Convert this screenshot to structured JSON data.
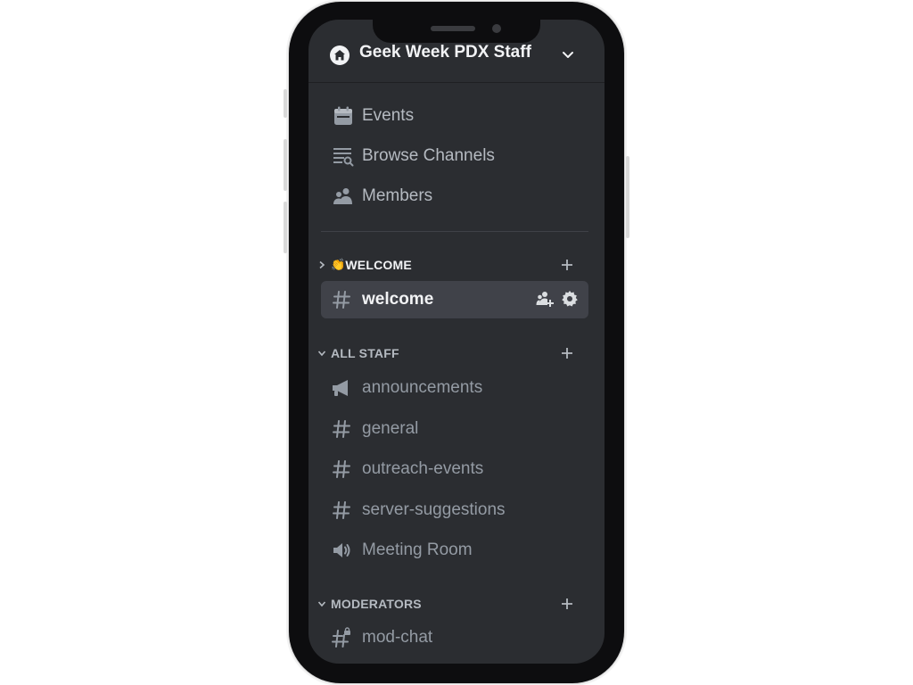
{
  "server": {
    "name": "Geek Week PDX Staff"
  },
  "nav": [
    {
      "label": "Events",
      "icon": "calendar-icon"
    },
    {
      "label": "Browse Channels",
      "icon": "browse-channels-icon"
    },
    {
      "label": "Members",
      "icon": "members-icon"
    }
  ],
  "categories": {
    "welcome": {
      "label": "WELCOME",
      "emoji": "👏"
    },
    "all_staff": {
      "label": "ALL STAFF"
    },
    "moderators": {
      "label": "MODERATORS"
    }
  },
  "channels": {
    "welcome": {
      "label": "welcome",
      "icon": "hash-icon"
    },
    "announcements": {
      "label": "announcements",
      "icon": "megaphone-icon"
    },
    "general": {
      "label": "general",
      "icon": "hash-icon"
    },
    "outreach_events": {
      "label": "outreach-events",
      "icon": "hash-icon"
    },
    "server_suggestions": {
      "label": "server-suggestions",
      "icon": "hash-icon"
    },
    "meeting_room": {
      "label": "Meeting Room",
      "icon": "speaker-icon"
    },
    "mod_chat": {
      "label": "mod-chat",
      "icon": "locked-hash-icon"
    }
  },
  "colors": {
    "background": "#2b2d31",
    "active_channel": "#404249",
    "text_muted": "#949ba4",
    "text_bright": "#f2f3f5"
  }
}
